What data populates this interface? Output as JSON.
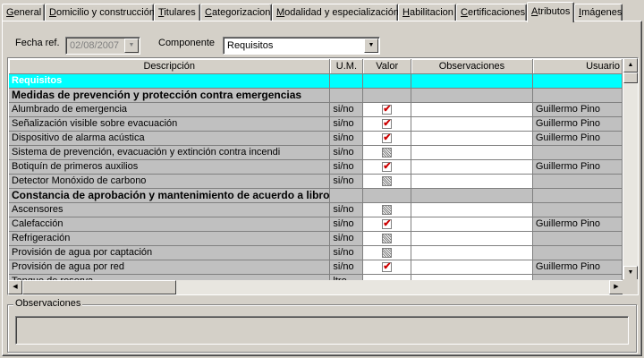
{
  "tabs": [
    {
      "label": "General",
      "ul": "G",
      "rest": "eneral"
    },
    {
      "label": "Domicilio y construcción",
      "ul": "D",
      "rest": "omicilio y construcción"
    },
    {
      "label": "Titulares",
      "ul": "T",
      "rest": "itulares"
    },
    {
      "label": "Categorizacion",
      "ul": "C",
      "rest": "ategorizacion"
    },
    {
      "label": "Modalidad y especialización",
      "ul": "M",
      "rest": "odalidad y especialización"
    },
    {
      "label": "Habilitacion",
      "ul": "H",
      "rest": "abilitacion"
    },
    {
      "label": "Certificaciones",
      "ul": "C",
      "rest": "ertificaciones"
    },
    {
      "label": "Atributos",
      "ul": "A",
      "rest": "tributos"
    },
    {
      "label": "Imágenes",
      "ul": "I",
      "rest": "mágenes"
    }
  ],
  "active_tab": "Atributos",
  "filters": {
    "fecha_label": "Fecha ref.",
    "fecha_value": "02/08/2007",
    "componente_label": "Componente",
    "componente_value": "Requisitos"
  },
  "grid": {
    "columns": [
      "Descripción",
      "U.M.",
      "Valor",
      "Observaciones",
      "Usuario"
    ],
    "rows": [
      {
        "type": "head",
        "desc": "Requisitos"
      },
      {
        "type": "group",
        "desc": "Medidas de prevención y protección contra emergencias"
      },
      {
        "type": "item",
        "desc": "Alumbrado de emergencia",
        "um": "si/no",
        "checked": true,
        "obs": "",
        "user": "Guillermo Pino"
      },
      {
        "type": "item",
        "desc": "Señalización visible sobre evacuación",
        "um": "si/no",
        "checked": true,
        "obs": "",
        "user": "Guillermo Pino"
      },
      {
        "type": "item",
        "desc": "Dispositivo de alarma acústica",
        "um": "si/no",
        "checked": true,
        "obs": "",
        "user": "Guillermo Pino"
      },
      {
        "type": "item",
        "desc": "Sistema de prevención, evacuación y extinción contra incendi",
        "um": "si/no",
        "checked": false,
        "obs": "",
        "user": ""
      },
      {
        "type": "item",
        "desc": "Botiquín de primeros auxilios",
        "um": "si/no",
        "checked": true,
        "obs": "",
        "user": "Guillermo Pino"
      },
      {
        "type": "item",
        "desc": "Detector Monóxido de carbono",
        "um": "si/no",
        "checked": false,
        "obs": "",
        "user": ""
      },
      {
        "type": "group",
        "desc": "Constancia de aprobación y mantenimiento de acuerdo a libro"
      },
      {
        "type": "item",
        "desc": "Ascensores",
        "um": "si/no",
        "checked": false,
        "obs": "",
        "user": ""
      },
      {
        "type": "item",
        "desc": "Calefacción",
        "um": "si/no",
        "checked": true,
        "obs": "",
        "user": "Guillermo Pino"
      },
      {
        "type": "item",
        "desc": "Refrigeración",
        "um": "si/no",
        "checked": false,
        "obs": "",
        "user": ""
      },
      {
        "type": "item",
        "desc": "Provisión de agua por captación",
        "um": "si/no",
        "checked": false,
        "obs": "",
        "user": ""
      },
      {
        "type": "item",
        "desc": "Provisión de agua por red",
        "um": "si/no",
        "checked": true,
        "obs": "",
        "user": "Guillermo Pino"
      },
      {
        "type": "item",
        "desc": "Tanque de reserva",
        "um": "ltro",
        "checked": null,
        "obs": "",
        "user": ""
      }
    ]
  },
  "observaciones": {
    "label": "Observaciones",
    "value": ""
  },
  "colors": {
    "header_row": "#00ffff",
    "check_mark": "#cc0000",
    "window_bg": "#d4d0c8"
  }
}
